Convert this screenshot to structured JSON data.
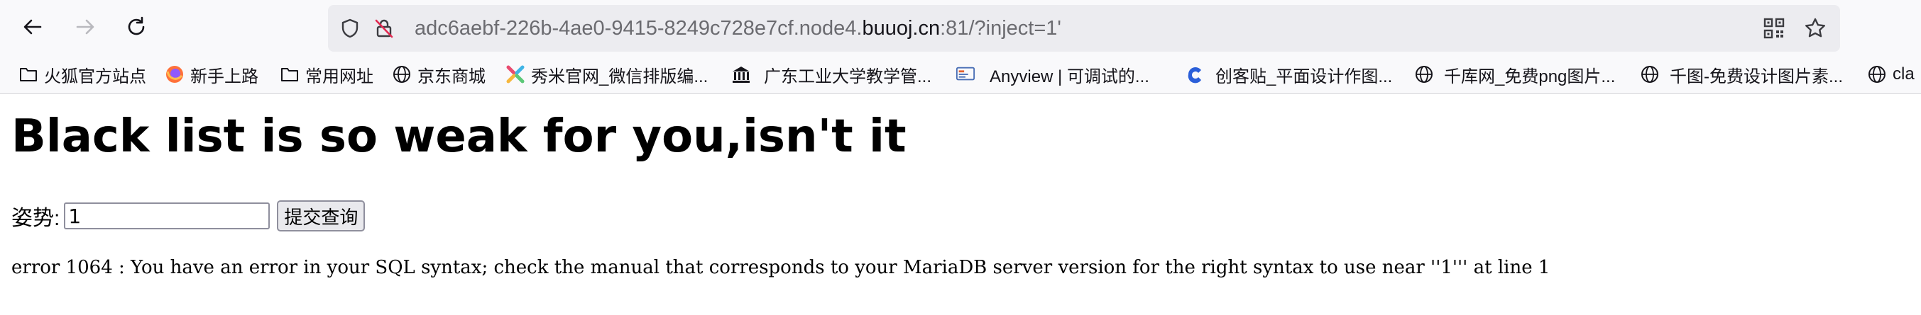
{
  "browser": {
    "url": {
      "prefix": "adc6aebf-226b-4ae0-9415-8249c728e7cf.node4.",
      "host": "buuoj.cn",
      "suffix": ":81/?inject=1'"
    },
    "icons": {
      "back": "arrow-left-icon",
      "forward": "arrow-right-icon",
      "reload": "reload-icon",
      "tracking": "shield-icon",
      "insecure": "insecure-lock-icon",
      "qr": "qr-code-icon",
      "bookmark": "star-icon"
    }
  },
  "bookmarks": [
    {
      "label": "火狐官方站点",
      "icon": "folder-icon"
    },
    {
      "label": "新手上路",
      "icon": "firefox-icon"
    },
    {
      "label": "常用网址",
      "icon": "folder-icon"
    },
    {
      "label": "京东商城",
      "icon": "globe-icon"
    },
    {
      "label": "秀米官网_微信排版编...",
      "icon": "xiumi-icon"
    },
    {
      "label": "广东工业大学教学管...",
      "icon": "university-icon"
    },
    {
      "label": "Anyview | 可调试的...",
      "icon": "anyview-icon"
    },
    {
      "label": "创客贴_平面设计作图...",
      "icon": "chuangke-icon"
    },
    {
      "label": "千库网_免费png图片...",
      "icon": "globe-icon"
    },
    {
      "label": "千图-免费设计图片素...",
      "icon": "globe-icon"
    },
    {
      "label": "cla",
      "icon": "globe-icon"
    }
  ],
  "page": {
    "title": "Black list is so weak for you,isn't it",
    "form": {
      "label": "姿势:",
      "input_value": "1",
      "submit_label": "提交查询"
    },
    "error": "error 1064 : You have an error in your SQL syntax; check the manual that corresponds to your MariaDB server version for the right syntax to use near ''1''' at line 1"
  },
  "colors": {
    "toolbar_bg": "#f9f9fb",
    "urlbar_bg": "#ececf0",
    "url_dim_text": "#6b6b70",
    "text": "#15141a"
  }
}
